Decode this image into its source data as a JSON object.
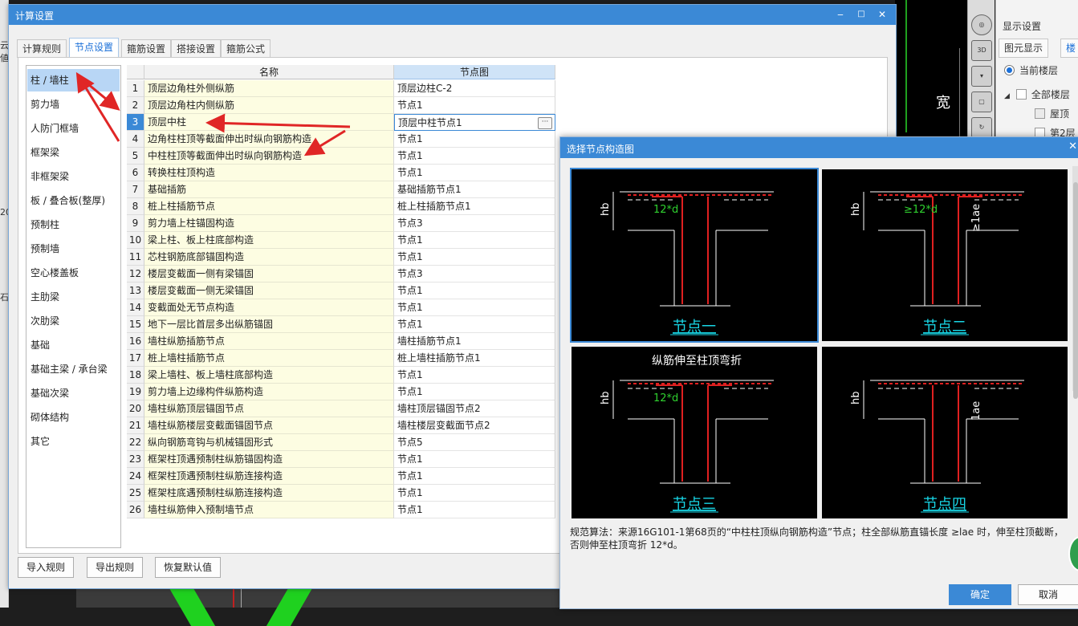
{
  "dialog": {
    "title": "计算设置",
    "minimize_glyph": "‒",
    "maximize_glyph": "□",
    "close_glyph": "✕",
    "tabs": [
      "计算规则",
      "节点设置",
      "箍筋设置",
      "搭接设置",
      "箍筋公式"
    ],
    "active_tab_index": 1,
    "categories": [
      "柱 / 墙柱",
      "剪力墙",
      "人防门框墙",
      "框架梁",
      "非框架梁",
      "板 / 叠合板(整厚)",
      "预制柱",
      "预制墙",
      "空心楼盖板",
      "主肋梁",
      "次肋梁",
      "基础",
      "基础主梁 / 承台梁",
      "基础次梁",
      "砌体结构",
      "其它"
    ],
    "selected_category_index": 0,
    "grid_headers": {
      "name": "名称",
      "node": "节点图"
    },
    "rows": [
      {
        "num": "1",
        "name": "顶层边角柱外侧纵筋",
        "node": "顶层边柱C-2"
      },
      {
        "num": "2",
        "name": "顶层边角柱内侧纵筋",
        "node": "节点1"
      },
      {
        "num": "3",
        "name": "顶层中柱",
        "node": "顶层中柱节点1"
      },
      {
        "num": "4",
        "name": "边角柱柱顶等截面伸出时纵向钢筋构造",
        "node": "节点1"
      },
      {
        "num": "5",
        "name": "中柱柱顶等截面伸出时纵向钢筋构造",
        "node": "节点1"
      },
      {
        "num": "6",
        "name": "转换柱柱顶构造",
        "node": "节点1"
      },
      {
        "num": "7",
        "name": "基础插筋",
        "node": "基础插筋节点1"
      },
      {
        "num": "8",
        "name": "桩上柱插筋节点",
        "node": "桩上柱插筋节点1"
      },
      {
        "num": "9",
        "name": "剪力墙上柱锚固构造",
        "node": "节点3"
      },
      {
        "num": "10",
        "name": "梁上柱、板上柱底部构造",
        "node": "节点1"
      },
      {
        "num": "11",
        "name": "芯柱钢筋底部锚固构造",
        "node": "节点1"
      },
      {
        "num": "12",
        "name": "楼层变截面一侧有梁锚固",
        "node": "节点3"
      },
      {
        "num": "13",
        "name": "楼层变截面一侧无梁锚固",
        "node": "节点1"
      },
      {
        "num": "14",
        "name": "变截面处无节点构造",
        "node": "节点1"
      },
      {
        "num": "15",
        "name": "地下一层比首层多出纵筋锚固",
        "node": "节点1"
      },
      {
        "num": "16",
        "name": "墙柱纵筋插筋节点",
        "node": "墙柱插筋节点1"
      },
      {
        "num": "17",
        "name": "桩上墙柱插筋节点",
        "node": "桩上墙柱插筋节点1"
      },
      {
        "num": "18",
        "name": "梁上墙柱、板上墙柱底部构造",
        "node": "节点1"
      },
      {
        "num": "19",
        "name": "剪力墙上边缘构件纵筋构造",
        "node": "节点1"
      },
      {
        "num": "20",
        "name": "墙柱纵筋顶层锚固节点",
        "node": "墙柱顶层锚固节点2"
      },
      {
        "num": "21",
        "name": "墙柱纵筋楼层变截面锚固节点",
        "node": "墙柱楼层变截面节点2"
      },
      {
        "num": "22",
        "name": "纵向钢筋弯钩与机械锚固形式",
        "node": "节点5"
      },
      {
        "num": "23",
        "name": "框架柱顶遇预制柱纵筋锚固构造",
        "node": "节点1"
      },
      {
        "num": "24",
        "name": "框架柱顶遇预制柱纵筋连接构造",
        "node": "节点1"
      },
      {
        "num": "25",
        "name": "框架柱底遇预制柱纵筋连接构造",
        "node": "节点1"
      },
      {
        "num": "26",
        "name": "墙柱纵筋伸入预制墙节点",
        "node": "节点1"
      }
    ],
    "selected_row_index": 2,
    "ellipsis_glyph": "···",
    "buttons": {
      "import": "导入规则",
      "export": "导出规则",
      "restore": "恢复默认值"
    }
  },
  "picker": {
    "title": "选择节点构造图",
    "close_glyph": "✕",
    "panels": [
      {
        "label": "节点一",
        "dim_text": "12*d",
        "hb": "hb",
        "lae": "",
        "caption": ""
      },
      {
        "label": "节点二",
        "dim_text": "≥12*d",
        "hb": "hb",
        "lae": "≥1ae",
        "caption": ""
      },
      {
        "label": "节点三",
        "dim_text": "12*d",
        "hb": "hb",
        "lae": "",
        "caption": "纵筋伸至柱顶弯折"
      },
      {
        "label": "节点四",
        "dim_text": "",
        "hb": "hb",
        "lae": "1ae",
        "caption": ""
      }
    ],
    "selected_panel_index": 0,
    "description": "规范算法：来源16G101-1第68页的“中柱柱顶纵向钢筋构造”节点；柱全部纵筋直锚长度 ≥lae 时，伸至柱顶截断，否则伸至柱顶弯折 12*d。",
    "ok_label": "确定",
    "cancel_label": "取消"
  },
  "display_panel": {
    "title": "显示设置",
    "tabs": [
      "图元显示",
      "楼"
    ],
    "radio_label": "当前楼层",
    "tree": [
      "全部楼层",
      "屋顶",
      "第2层"
    ]
  },
  "cad": {
    "wall_label": "宽",
    "view3d_label": "3D"
  },
  "background_fragments": [
    "云値",
    "20",
    "石"
  ],
  "colors": {
    "accent": "#3b89d6",
    "name_cell_bg": "#fdfde2",
    "cad_rebar_red": "#e02020",
    "cad_dim_green": "#2fd12f",
    "cad_label_cyan": "#18d6e6",
    "annotation_arrow_red": "#e02626"
  }
}
